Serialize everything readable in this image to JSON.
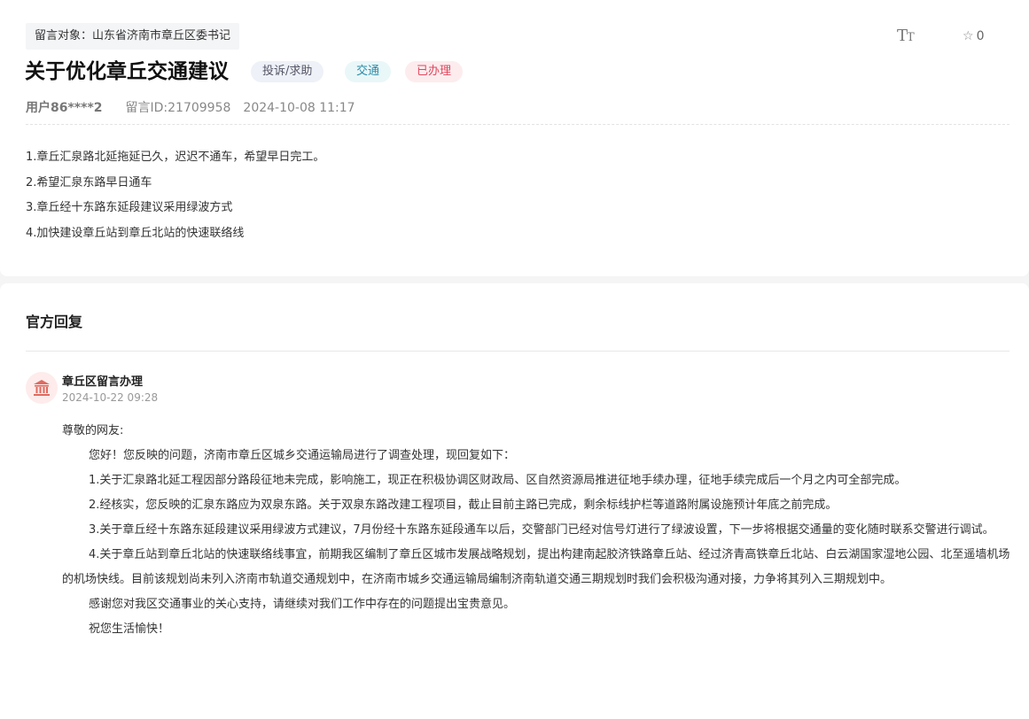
{
  "message": {
    "target_label": "留言对象：山东省济南市章丘区委书记",
    "favorite_count": "0",
    "title": "关于优化章丘交通建议",
    "tags": [
      "投诉/求助",
      "交通",
      "已办理"
    ],
    "user": "用户86****2",
    "message_id": "留言ID:21709958",
    "datetime": "2024-10-08 11:17",
    "content": [
      "1.章丘汇泉路北延拖延已久，迟迟不通车，希望早日完工。",
      "2.希望汇泉东路早日通车",
      "3.章丘经十东路东延段建议采用绿波方式",
      "4.加快建设章丘站到章丘北站的快速联络线"
    ]
  },
  "reply": {
    "section_title": "官方回复",
    "replier": "章丘区留言办理",
    "date": "2024-10-22 09:28",
    "greeting": "尊敬的网友:",
    "paragraphs": [
      "您好！您反映的问题，济南市章丘区城乡交通运输局进行了调查处理，现回复如下：",
      "1.关于汇泉路北延工程因部分路段征地未完成，影响施工，现正在积极协调区财政局、区自然资源局推进征地手续办理，征地手续完成后一个月之内可全部完成。",
      "2.经核实，您反映的汇泉东路应为双泉东路。关于双泉东路改建工程项目，截止目前主路已完成，剩余标线护栏等道路附属设施预计年底之前完成。",
      "3.关于章丘经十东路东延段建议采用绿波方式建议，7月份经十东路东延段通车以后，交警部门已经对信号灯进行了绿波设置，下一步将根据交通量的变化随时联系交警进行调试。",
      "4.关于章丘站到章丘北站的快速联络线事宜，前期我区编制了章丘区城市发展战略规划，提出构建南起胶济铁路章丘站、经过济青高铁章丘北站、白云湖国家湿地公园、北至遥墙机场的机场快线。目前该规划尚未列入济南市轨道交通规划中，在济南市城乡交通运输局编制济南轨道交通三期规划时我们会积极沟通对接，力争将其列入三期规划中。",
      "感谢您对我区交通事业的关心支持，请继续对我们工作中存在的问题提出宝贵意见。",
      "祝您生活愉快！"
    ]
  },
  "icons": {
    "font_size": "font-size-icon",
    "favorite": "star-outline-icon",
    "avatar": "government-building-icon"
  },
  "colors": {
    "tag_type_text": "#555566",
    "tag_category_text": "#2a8ba8",
    "tag_status_text": "#e0475c",
    "avatar_icon": "#e06a5f"
  }
}
